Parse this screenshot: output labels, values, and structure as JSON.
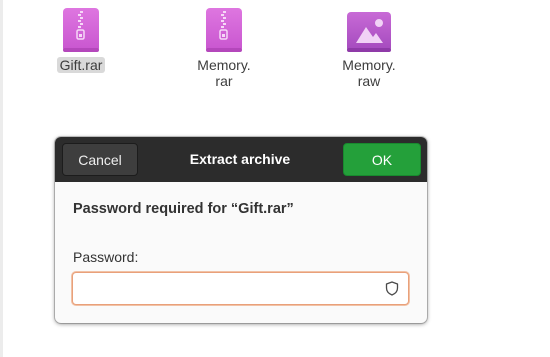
{
  "files": [
    {
      "name": "Gift.rar",
      "icon": "archive-file-icon",
      "selected": true
    },
    {
      "name": "Memory.\nrar",
      "icon": "archive-file-icon",
      "selected": false
    },
    {
      "name": "Memory.\nraw",
      "icon": "image-file-icon",
      "selected": false
    }
  ],
  "dialog": {
    "title": "Extract archive",
    "cancel_label": "Cancel",
    "ok_label": "OK",
    "prompt": "Password required for “Gift.rar”",
    "password_label": "Password:",
    "password_value": "",
    "password_icon": "shield-icon"
  },
  "colors": {
    "archive_icon": "#d565d9",
    "image_icon": "#b056c6",
    "ok_button": "#24a03a",
    "titlebar": "#2c2c2c",
    "input_focus_border": "#e9a07a"
  }
}
